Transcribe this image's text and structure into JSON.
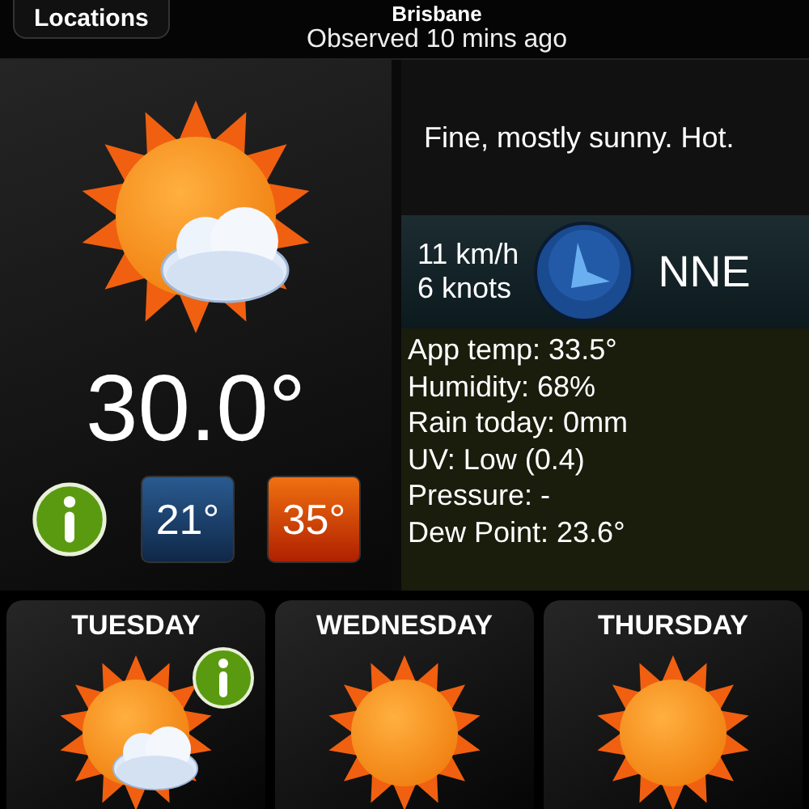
{
  "header": {
    "back_button": "Locations",
    "title": "Brisbane",
    "subtitle": "Observed 10 mins ago"
  },
  "current": {
    "kind": "cloudy",
    "temperature": "30.0°",
    "min": "21°",
    "max": "35°",
    "description": "Fine, mostly sunny. Hot.",
    "wind": {
      "speed_kmh": "11 km/h",
      "speed_knots": "6 knots",
      "direction": "NNE"
    },
    "details": [
      "App temp: 33.5°",
      "Humidity: 68%",
      "Rain today: 0mm",
      "UV: Low (0.4)",
      "Pressure: -",
      "Dew Point: 23.6°"
    ]
  },
  "forecast": [
    {
      "day": "TUESDAY",
      "kind": "cloudy",
      "info": true
    },
    {
      "day": "WEDNESDAY",
      "kind": "sunny",
      "info": false
    },
    {
      "day": "THURSDAY",
      "kind": "sunny",
      "info": false
    }
  ]
}
